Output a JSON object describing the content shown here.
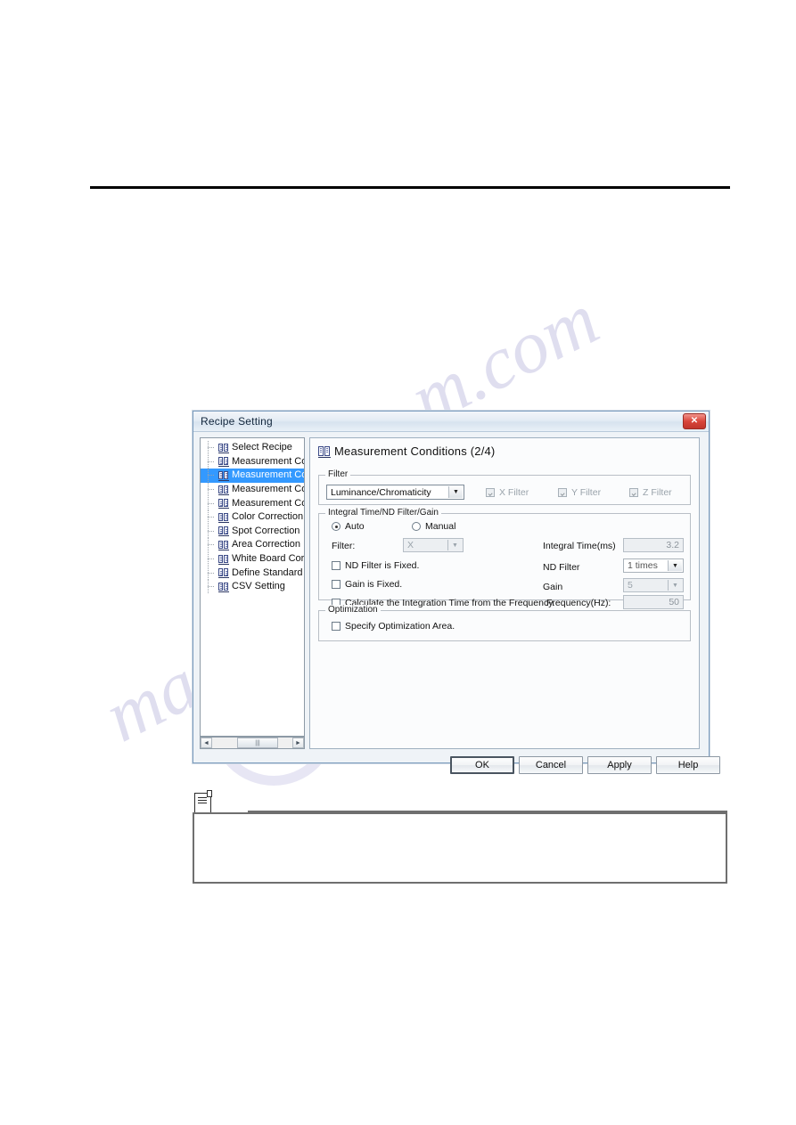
{
  "document": {
    "note_block": {
      "icon": "note-icon",
      "body_text": ""
    }
  },
  "dialog": {
    "title": "Recipe Setting",
    "close_label": "✕",
    "tree": {
      "items": [
        {
          "label": "Select Recipe",
          "selected": false
        },
        {
          "label": "Measurement Co",
          "selected": false
        },
        {
          "label": "Measurement Co",
          "selected": true
        },
        {
          "label": "Measurement Co",
          "selected": false
        },
        {
          "label": "Measurement Co",
          "selected": false
        },
        {
          "label": "Color Correction",
          "selected": false
        },
        {
          "label": "Spot Correction",
          "selected": false
        },
        {
          "label": "Area Correction",
          "selected": false
        },
        {
          "label": "White Board Corr",
          "selected": false
        },
        {
          "label": "Define Standard ",
          "selected": false
        },
        {
          "label": "CSV Setting",
          "selected": false
        }
      ],
      "scroll_left_arrow": "◄",
      "scroll_right_arrow": "►",
      "scroll_thumb_glyph": "|||"
    },
    "pane": {
      "title": "Measurement Conditions (2/4)",
      "filter_group": {
        "legend": "Filter",
        "mode_value": "Luminance/Chromaticity",
        "combo_arrow": "▼",
        "x_filter_label": "X Filter",
        "y_filter_label": "Y Filter",
        "z_filter_label": "Z Filter"
      },
      "integral_group": {
        "legend": "Integral Time/ND Filter/Gain",
        "auto_label": "Auto",
        "manual_label": "Manual",
        "filter_label": "Filter:",
        "filter_value": "X",
        "nd_filter_fixed_label": "ND Filter is Fixed.",
        "gain_fixed_label": "Gain is Fixed.",
        "calculate_label": "Calculate the Integration Time from the Frequency.",
        "integral_time_label": "Integral Time(ms)",
        "integral_time_value": "3.2",
        "nd_filter_label": "ND Filter",
        "nd_filter_value": "1 times",
        "gain_label": "Gain",
        "gain_value": "5",
        "frequency_label": "Frequency(Hz):",
        "frequency_value": "50",
        "combo_arrow": "▼"
      },
      "optimization_group": {
        "legend": "Optimization",
        "specify_area_label": "Specify Optimization Area."
      }
    },
    "buttons": {
      "ok": "OK",
      "cancel": "Cancel",
      "apply": "Apply",
      "help": "Help"
    }
  },
  "watermark": {
    "line1": "m.com",
    "line2": "manualsarchive"
  },
  "colors": {
    "selection": "#3399ff",
    "title_bar": "#e4ecf4",
    "close_button": "#d9453b",
    "dialog_bg": "#eff3f7"
  }
}
